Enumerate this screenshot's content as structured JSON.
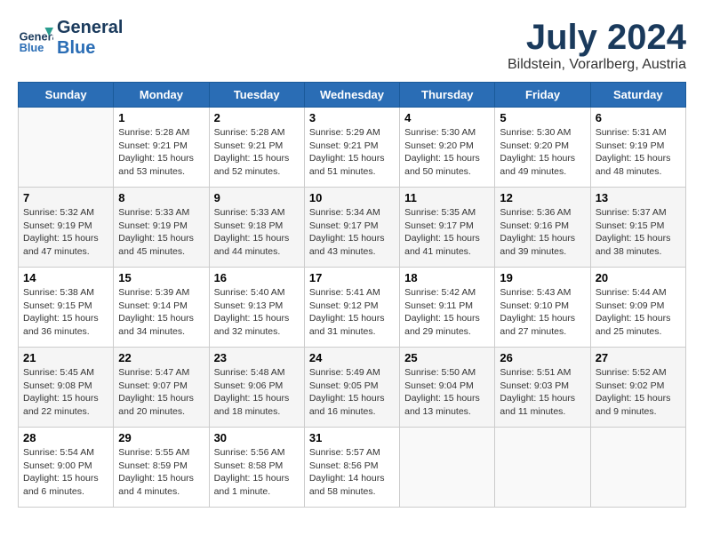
{
  "header": {
    "logo_line1": "General",
    "logo_line2": "Blue",
    "month": "July 2024",
    "location": "Bildstein, Vorarlberg, Austria"
  },
  "days_of_week": [
    "Sunday",
    "Monday",
    "Tuesday",
    "Wednesday",
    "Thursday",
    "Friday",
    "Saturday"
  ],
  "weeks": [
    [
      {
        "day": "",
        "info": ""
      },
      {
        "day": "1",
        "info": "Sunrise: 5:28 AM\nSunset: 9:21 PM\nDaylight: 15 hours\nand 53 minutes."
      },
      {
        "day": "2",
        "info": "Sunrise: 5:28 AM\nSunset: 9:21 PM\nDaylight: 15 hours\nand 52 minutes."
      },
      {
        "day": "3",
        "info": "Sunrise: 5:29 AM\nSunset: 9:21 PM\nDaylight: 15 hours\nand 51 minutes."
      },
      {
        "day": "4",
        "info": "Sunrise: 5:30 AM\nSunset: 9:20 PM\nDaylight: 15 hours\nand 50 minutes."
      },
      {
        "day": "5",
        "info": "Sunrise: 5:30 AM\nSunset: 9:20 PM\nDaylight: 15 hours\nand 49 minutes."
      },
      {
        "day": "6",
        "info": "Sunrise: 5:31 AM\nSunset: 9:19 PM\nDaylight: 15 hours\nand 48 minutes."
      }
    ],
    [
      {
        "day": "7",
        "info": "Sunrise: 5:32 AM\nSunset: 9:19 PM\nDaylight: 15 hours\nand 47 minutes."
      },
      {
        "day": "8",
        "info": "Sunrise: 5:33 AM\nSunset: 9:19 PM\nDaylight: 15 hours\nand 45 minutes."
      },
      {
        "day": "9",
        "info": "Sunrise: 5:33 AM\nSunset: 9:18 PM\nDaylight: 15 hours\nand 44 minutes."
      },
      {
        "day": "10",
        "info": "Sunrise: 5:34 AM\nSunset: 9:17 PM\nDaylight: 15 hours\nand 43 minutes."
      },
      {
        "day": "11",
        "info": "Sunrise: 5:35 AM\nSunset: 9:17 PM\nDaylight: 15 hours\nand 41 minutes."
      },
      {
        "day": "12",
        "info": "Sunrise: 5:36 AM\nSunset: 9:16 PM\nDaylight: 15 hours\nand 39 minutes."
      },
      {
        "day": "13",
        "info": "Sunrise: 5:37 AM\nSunset: 9:15 PM\nDaylight: 15 hours\nand 38 minutes."
      }
    ],
    [
      {
        "day": "14",
        "info": "Sunrise: 5:38 AM\nSunset: 9:15 PM\nDaylight: 15 hours\nand 36 minutes."
      },
      {
        "day": "15",
        "info": "Sunrise: 5:39 AM\nSunset: 9:14 PM\nDaylight: 15 hours\nand 34 minutes."
      },
      {
        "day": "16",
        "info": "Sunrise: 5:40 AM\nSunset: 9:13 PM\nDaylight: 15 hours\nand 32 minutes."
      },
      {
        "day": "17",
        "info": "Sunrise: 5:41 AM\nSunset: 9:12 PM\nDaylight: 15 hours\nand 31 minutes."
      },
      {
        "day": "18",
        "info": "Sunrise: 5:42 AM\nSunset: 9:11 PM\nDaylight: 15 hours\nand 29 minutes."
      },
      {
        "day": "19",
        "info": "Sunrise: 5:43 AM\nSunset: 9:10 PM\nDaylight: 15 hours\nand 27 minutes."
      },
      {
        "day": "20",
        "info": "Sunrise: 5:44 AM\nSunset: 9:09 PM\nDaylight: 15 hours\nand 25 minutes."
      }
    ],
    [
      {
        "day": "21",
        "info": "Sunrise: 5:45 AM\nSunset: 9:08 PM\nDaylight: 15 hours\nand 22 minutes."
      },
      {
        "day": "22",
        "info": "Sunrise: 5:47 AM\nSunset: 9:07 PM\nDaylight: 15 hours\nand 20 minutes."
      },
      {
        "day": "23",
        "info": "Sunrise: 5:48 AM\nSunset: 9:06 PM\nDaylight: 15 hours\nand 18 minutes."
      },
      {
        "day": "24",
        "info": "Sunrise: 5:49 AM\nSunset: 9:05 PM\nDaylight: 15 hours\nand 16 minutes."
      },
      {
        "day": "25",
        "info": "Sunrise: 5:50 AM\nSunset: 9:04 PM\nDaylight: 15 hours\nand 13 minutes."
      },
      {
        "day": "26",
        "info": "Sunrise: 5:51 AM\nSunset: 9:03 PM\nDaylight: 15 hours\nand 11 minutes."
      },
      {
        "day": "27",
        "info": "Sunrise: 5:52 AM\nSunset: 9:02 PM\nDaylight: 15 hours\nand 9 minutes."
      }
    ],
    [
      {
        "day": "28",
        "info": "Sunrise: 5:54 AM\nSunset: 9:00 PM\nDaylight: 15 hours\nand 6 minutes."
      },
      {
        "day": "29",
        "info": "Sunrise: 5:55 AM\nSunset: 8:59 PM\nDaylight: 15 hours\nand 4 minutes."
      },
      {
        "day": "30",
        "info": "Sunrise: 5:56 AM\nSunset: 8:58 PM\nDaylight: 15 hours\nand 1 minute."
      },
      {
        "day": "31",
        "info": "Sunrise: 5:57 AM\nSunset: 8:56 PM\nDaylight: 14 hours\nand 58 minutes."
      },
      {
        "day": "",
        "info": ""
      },
      {
        "day": "",
        "info": ""
      },
      {
        "day": "",
        "info": ""
      }
    ]
  ]
}
